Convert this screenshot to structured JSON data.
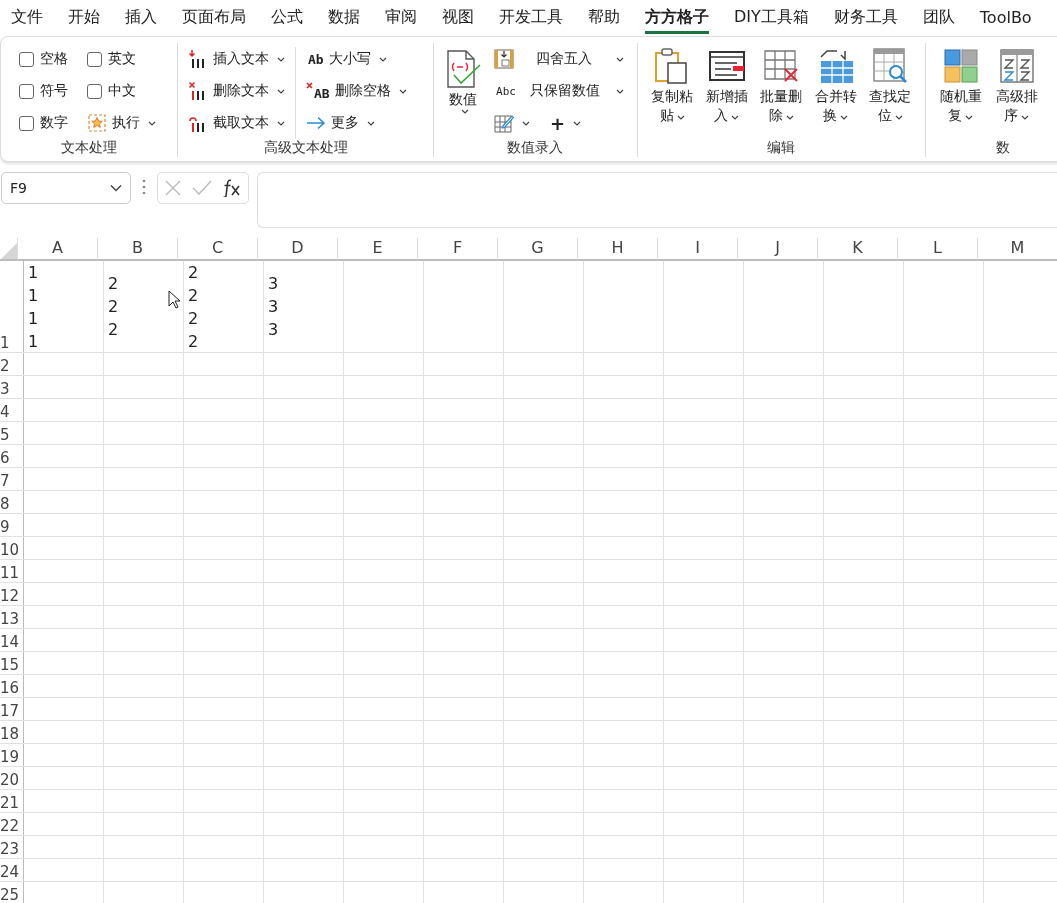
{
  "tabs": [
    {
      "label": "文件",
      "selected": false
    },
    {
      "label": "开始",
      "selected": false
    },
    {
      "label": "插入",
      "selected": false
    },
    {
      "label": "页面布局",
      "selected": false
    },
    {
      "label": "公式",
      "selected": false
    },
    {
      "label": "数据",
      "selected": false
    },
    {
      "label": "审阅",
      "selected": false
    },
    {
      "label": "视图",
      "selected": false
    },
    {
      "label": "开发工具",
      "selected": false
    },
    {
      "label": "帮助",
      "selected": false
    },
    {
      "label": "方方格子",
      "selected": true
    },
    {
      "label": "DIY工具箱",
      "selected": false
    },
    {
      "label": "财务工具",
      "selected": false
    },
    {
      "label": "团队",
      "selected": false
    },
    {
      "label": "ToolBo",
      "selected": false
    }
  ],
  "ribbon": {
    "groups": [
      {
        "kind": "checks",
        "label": "文本处理",
        "items": [
          {
            "kind": "checkbox",
            "label": "空格",
            "checked": false
          },
          {
            "kind": "checkbox",
            "label": "符号",
            "checked": false
          },
          {
            "kind": "checkbox",
            "label": "数字",
            "checked": false
          },
          {
            "kind": "checkbox",
            "label": "英文",
            "checked": false
          },
          {
            "kind": "checkbox",
            "label": "中文",
            "checked": false
          },
          {
            "kind": "menu",
            "label": "执行"
          }
        ]
      },
      {
        "kind": "columns",
        "label": "高级文本处理",
        "columns": [
          [
            {
              "label": "插入文本"
            },
            {
              "label": "删除文本"
            },
            {
              "label": "截取文本"
            }
          ],
          [
            {
              "label": "大小写",
              "glyph": "Ab"
            },
            {
              "label": "删除空格",
              "glyph": "AB"
            },
            {
              "label": "更多"
            }
          ]
        ]
      },
      {
        "kind": "mixed",
        "label": "数值录入",
        "large": {
          "label": "数值"
        },
        "items": [
          {
            "kind": "menu",
            "label": "四舍五入"
          },
          {
            "kind": "menu",
            "label": "只保留数值",
            "glyph": "Abc"
          },
          {
            "kind": "iconmenu"
          },
          {
            "kind": "charmenu",
            "label": "+"
          }
        ]
      },
      {
        "kind": "large",
        "label": "编辑",
        "items": [
          {
            "label": "复制粘贴"
          },
          {
            "label": "新增插入"
          },
          {
            "label": "批量删除"
          },
          {
            "label": "合并转换"
          },
          {
            "label": "查找定位"
          }
        ]
      },
      {
        "kind": "large",
        "label": "数",
        "items": [
          {
            "label": "随机重复"
          },
          {
            "label": "高级排序"
          }
        ]
      }
    ]
  },
  "formula_bar": {
    "name_box": "F9"
  },
  "sheet": {
    "columns": [
      "A",
      "B",
      "C",
      "D",
      "E",
      "F",
      "G",
      "H",
      "I",
      "J",
      "K",
      "L",
      "M"
    ],
    "rows": [
      {
        "label": "1",
        "cells": [
          "1\n1\n1\n1",
          "2\n2\n2",
          "2\n2\n2\n2",
          "3\n3\n3"
        ]
      },
      {
        "label": "2",
        "cells": []
      },
      {
        "label": "3",
        "cells": []
      },
      {
        "label": "4",
        "cells": []
      },
      {
        "label": "5",
        "cells": []
      },
      {
        "label": "6",
        "cells": []
      },
      {
        "label": "7",
        "cells": []
      },
      {
        "label": "8",
        "cells": []
      },
      {
        "label": "9",
        "cells": []
      },
      {
        "label": "10",
        "cells": []
      },
      {
        "label": "11",
        "cells": []
      },
      {
        "label": "12",
        "cells": []
      },
      {
        "label": "13",
        "cells": []
      },
      {
        "label": "14",
        "cells": []
      },
      {
        "label": "15",
        "cells": []
      },
      {
        "label": "16",
        "cells": []
      },
      {
        "label": "17",
        "cells": []
      },
      {
        "label": "18",
        "cells": []
      },
      {
        "label": "19",
        "cells": []
      },
      {
        "label": "20",
        "cells": []
      },
      {
        "label": "21",
        "cells": []
      },
      {
        "label": "22",
        "cells": []
      },
      {
        "label": "23",
        "cells": []
      },
      {
        "label": "24",
        "cells": []
      },
      {
        "label": "25",
        "cells": []
      }
    ]
  }
}
